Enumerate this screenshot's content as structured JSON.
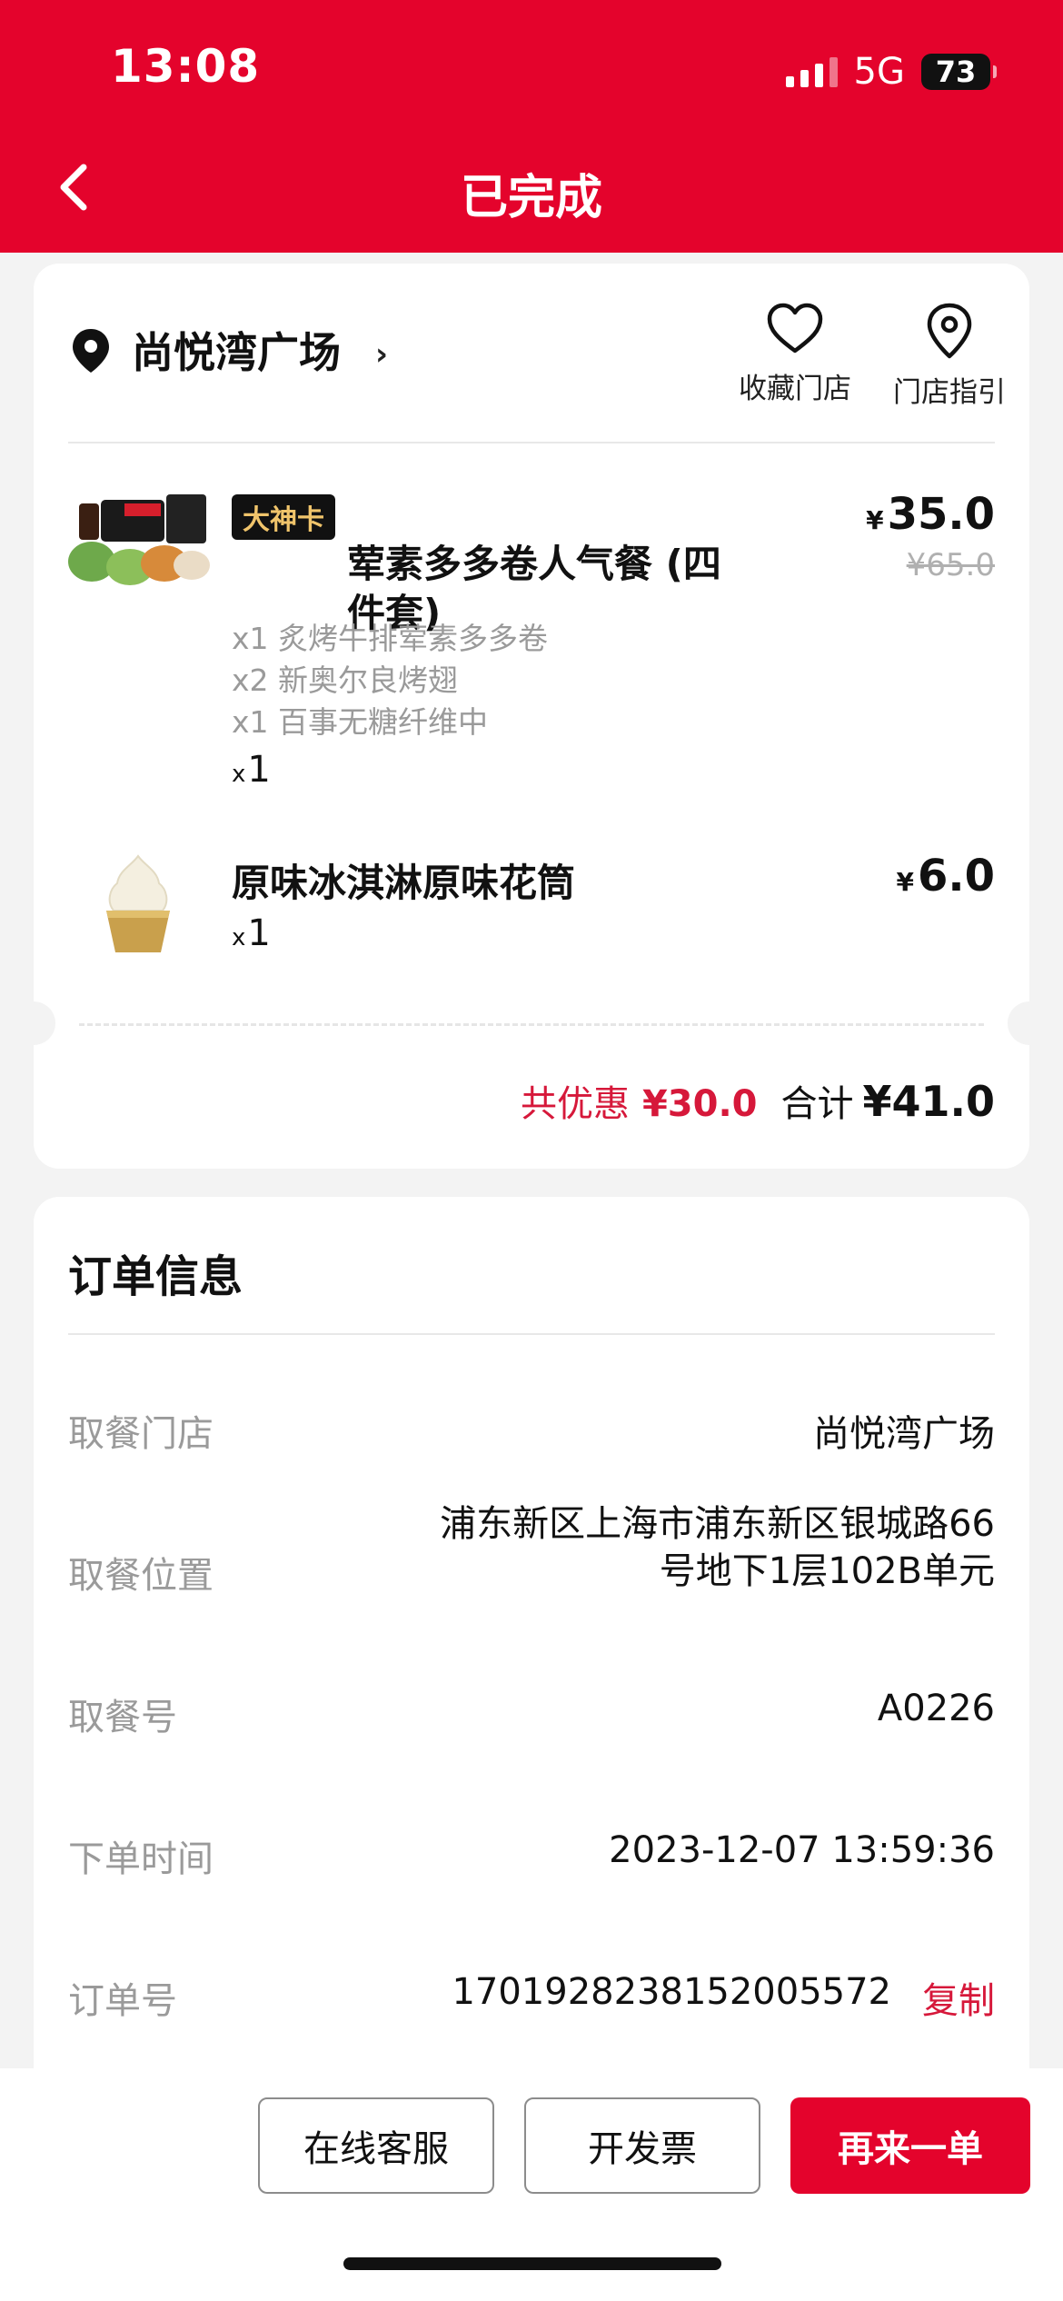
{
  "status_bar": {
    "time": "13:08",
    "network": "5G",
    "battery": "73"
  },
  "header": {
    "title": "已完成"
  },
  "store": {
    "name": "尚悦湾广场",
    "favorite_label": "收藏门店",
    "guide_label": "门店指引"
  },
  "items": [
    {
      "badge": "大神卡",
      "name": "荤素多多卷人气餐 (四件套)",
      "price_currency": "¥",
      "price": "35.0",
      "original_price": "¥65.0",
      "sub_items": [
        "x1 炙烤牛排荤素多多卷",
        "x2 新奥尔良烤翅",
        "x1 百事无糖纤维中"
      ],
      "qty_prefix": "x",
      "qty": "1"
    },
    {
      "name": "原味冰淇淋原味花筒",
      "price_currency": "¥",
      "price": "6.0",
      "qty_prefix": "x",
      "qty": "1"
    }
  ],
  "summary": {
    "discount_label": "共优惠",
    "discount_amount": "¥30.0",
    "total_label": "合计",
    "total_amount": "¥41.0"
  },
  "order_info": {
    "title": "订单信息",
    "rows": [
      {
        "label": "取餐门店",
        "value": "尚悦湾广场"
      },
      {
        "label": "取餐位置",
        "value_line1": "浦东新区上海市浦东新区银城路66",
        "value_line2": "号地下1层102B单元"
      },
      {
        "label": "取餐号",
        "value": "A0226"
      },
      {
        "label": "下单时间",
        "value": "2023-12-07 13:59:36"
      },
      {
        "label": "订单号",
        "value": "1701928238152005572",
        "action": "复制"
      }
    ]
  },
  "actions": {
    "service": "在线客服",
    "invoice": "开发票",
    "reorder": "再来一单"
  },
  "colors": {
    "brand_red": "#e4032c",
    "discount_red": "#d6183a",
    "badge_gold": "#f0c46b"
  }
}
